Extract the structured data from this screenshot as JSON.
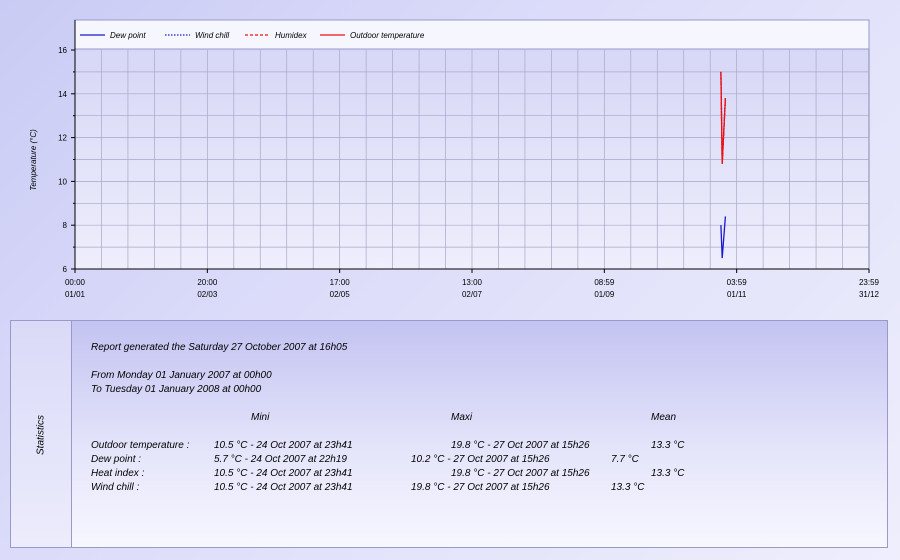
{
  "chart_data": {
    "type": "line",
    "ylabel": "Temperature (°C)",
    "ylim": [
      6,
      16
    ],
    "y_ticks": [
      "6",
      "8",
      "10",
      "12",
      "14",
      "16"
    ],
    "x_ticks": [
      {
        "time": "00:00",
        "date": "01/01"
      },
      {
        "time": "20:00",
        "date": "02/03"
      },
      {
        "time": "17:00",
        "date": "02/05"
      },
      {
        "time": "13:00",
        "date": "02/07"
      },
      {
        "time": "08:59",
        "date": "01/09"
      },
      {
        "time": "03:59",
        "date": "01/11"
      },
      {
        "time": "23:59",
        "date": "31/12"
      }
    ],
    "x_range": [
      "01/01 00:00",
      "31/12 23:59"
    ],
    "grid": true,
    "legend_position": "top",
    "series": [
      {
        "name": "Dew point",
        "color": "#1a1acc",
        "style": "solid",
        "points": [
          {
            "x": "24/10 22:00",
            "y": 8.0
          },
          {
            "x": "25/10 12:00",
            "y": 6.5
          },
          {
            "x": "27/10 00:00",
            "y": 8.4
          }
        ]
      },
      {
        "name": "Wind chill",
        "color": "#1a1acc",
        "style": "dotted",
        "points": [
          {
            "x": "24/10 22:00",
            "y": 15.0
          },
          {
            "x": "25/10 12:00",
            "y": 10.8
          },
          {
            "x": "27/10 00:00",
            "y": 13.8
          }
        ]
      },
      {
        "name": "Humidex",
        "color": "#ee1111",
        "style": "dashed",
        "points": [
          {
            "x": "24/10 22:00",
            "y": 15.0
          },
          {
            "x": "25/10 12:00",
            "y": 10.8
          },
          {
            "x": "27/10 00:00",
            "y": 13.8
          }
        ]
      },
      {
        "name": "Outdoor temperature",
        "color": "#ee1111",
        "style": "solid",
        "points": [
          {
            "x": "24/10 22:00",
            "y": 15.0
          },
          {
            "x": "25/10 12:00",
            "y": 10.8
          },
          {
            "x": "27/10 00:00",
            "y": 13.8
          }
        ]
      }
    ]
  },
  "statistics": {
    "side_label": "Statistics",
    "report_line": "Report generated the Saturday 27 October 2007 at 16h05",
    "from_line": "From Monday 01 January 2007 at 00h00",
    "to_line": "To Tuesday 01 January 2008 at 00h00",
    "headers": {
      "min": "Mini",
      "max": "Maxi",
      "mean": "Mean"
    },
    "rows": [
      {
        "label": "Outdoor temperature :",
        "min": "10.5 °C - 24 Oct 2007 at 23h41",
        "max": "19.8 °C - 27 Oct 2007 at 15h26",
        "mean": "13.3 °C"
      },
      {
        "label": "Dew point :",
        "min": "5.7 °C - 24 Oct 2007 at 22h19",
        "max": "10.2 °C - 27 Oct 2007 at 15h26",
        "mean": "7.7 °C"
      },
      {
        "label": "Heat index :",
        "min": "10.5 °C - 24 Oct 2007 at 23h41",
        "max": "19.8 °C - 27 Oct 2007 at 15h26",
        "mean": "13.3 °C"
      },
      {
        "label": "Wind chill :",
        "min": "10.5 °C - 24 Oct 2007 at 23h41",
        "max": "19.8 °C - 27 Oct 2007 at 15h26",
        "mean": "13.3 °C"
      }
    ]
  }
}
